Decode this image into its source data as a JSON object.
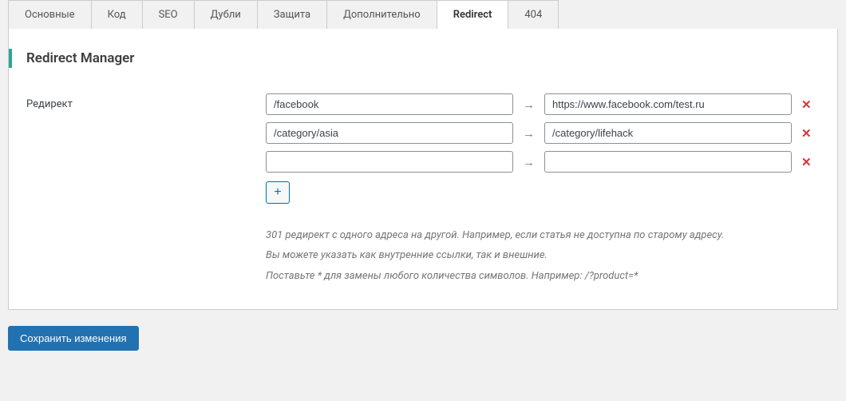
{
  "tabs": [
    {
      "label": "Основные",
      "active": false
    },
    {
      "label": "Код",
      "active": false
    },
    {
      "label": "SEO",
      "active": false
    },
    {
      "label": "Дубли",
      "active": false
    },
    {
      "label": "Защита",
      "active": false
    },
    {
      "label": "Дополнительно",
      "active": false
    },
    {
      "label": "Redirect",
      "active": true
    },
    {
      "label": "404",
      "active": false
    }
  ],
  "section": {
    "title": "Redirect Manager",
    "field_label": "Редирект",
    "arrow": "→",
    "delete_label": "✕",
    "add_label": "+",
    "redirects": [
      {
        "from": "/facebook",
        "to": "https://www.facebook.com/test.ru"
      },
      {
        "from": "/category/asia",
        "to": "/category/lifehack"
      },
      {
        "from": "",
        "to": ""
      }
    ],
    "description": [
      "301 редирект с одного адреса на другой. Например, если статья не доступна по старому адресу.",
      "Вы можете указать как внутренние ссылки, так и внешние.",
      "Поставьте * для замены любого количества символов. Например: /?product=*"
    ]
  },
  "save_button": "Сохранить изменения"
}
